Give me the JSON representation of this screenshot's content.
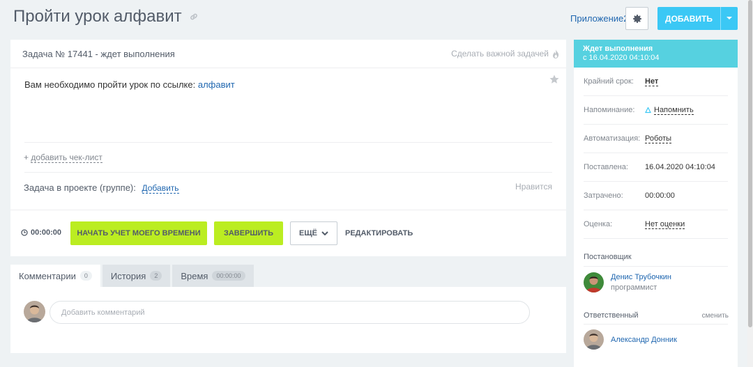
{
  "header": {
    "title": "Пройти урок алфавит",
    "apps_link": "Приложение2",
    "add_button": "ДОБАВИТЬ"
  },
  "task": {
    "heading": "Задача № 17441 - ждет выполнения",
    "make_important": "Сделать важной задачей",
    "description_prefix": "Вам необходимо пройти урок по ссылке:",
    "description_link": "алфавит",
    "add_checklist_plus": "+",
    "add_checklist": "добавить чек-лист",
    "project_label": "Задача в проекте (группе):",
    "project_add": "Добавить",
    "likes": "Нравится",
    "timer": "00:00:00",
    "btn_start_time": "НАЧАТЬ УЧЕТ МОЕГО ВРЕМЕНИ",
    "btn_finish": "ЗАВЕРШИТЬ",
    "btn_more": "ЕЩЁ",
    "btn_edit": "РЕДАКТИРОВАТЬ"
  },
  "tabs": [
    {
      "label": "Комментарии",
      "count": "0"
    },
    {
      "label": "История",
      "count": "2"
    },
    {
      "label": "Время",
      "count": "00:00:00"
    }
  ],
  "comments": {
    "placeholder": "Добавить комментарий"
  },
  "sidebar": {
    "status_title": "Ждет выполнения",
    "status_since": "с 16.04.2020 04:10:04",
    "rows": [
      {
        "key": "Крайний срок:",
        "value": "Нет"
      },
      {
        "key": "Напоминание:",
        "value": "Напомнить"
      },
      {
        "key": "Автоматизация:",
        "value": "Роботы"
      },
      {
        "key": "Поставлена:",
        "value": "16.04.2020 04:10:04"
      },
      {
        "key": "Затрачено:",
        "value": "00:00:00"
      },
      {
        "key": "Оценка:",
        "value": "Нет оценки"
      }
    ],
    "creator_label": "Постановщик",
    "creator_name": "Денис Трубочкин",
    "creator_role": "программист",
    "responsible_label": "Ответственный",
    "change": "сменить",
    "responsible_name": "Александр Донник"
  },
  "colors": {
    "accent_blue": "#3bc8f5",
    "green": "#bbed21",
    "status_teal": "#56d1e0",
    "link": "#2067b0"
  }
}
